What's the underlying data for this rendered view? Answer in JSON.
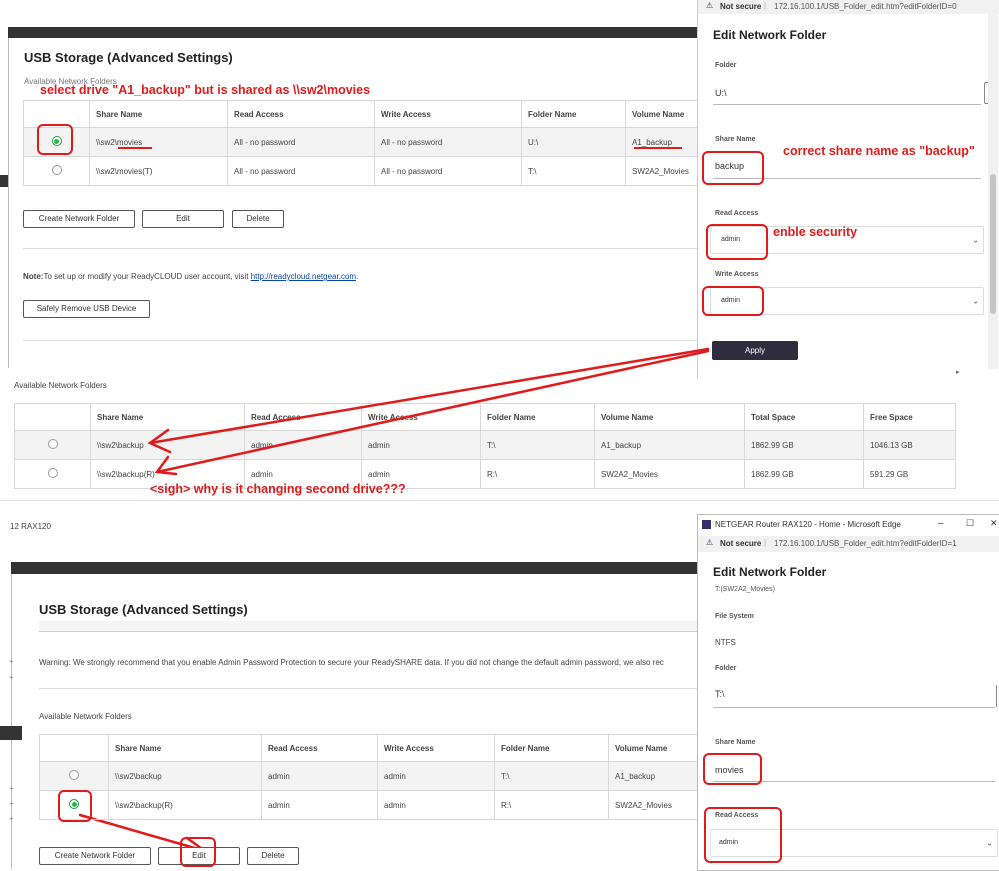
{
  "top": {
    "page_title": "USB Storage (Advanced Settings)",
    "available_label": "Available Network Folders",
    "columns": [
      "Share Name",
      "Read Access",
      "Write Access",
      "Folder Name",
      "Volume Name"
    ],
    "rows": [
      {
        "share_prefix": "\\\\sw2\\",
        "share_suffix": "movies",
        "read": "All - no password",
        "write": "All - no password",
        "folder": "U:\\",
        "volume": "A1_backup",
        "selected": true
      },
      {
        "share_prefix": "\\\\sw2\\",
        "share_suffix": "movies(T)",
        "read": "All - no password",
        "write": "All - no password",
        "folder": "T:\\",
        "volume": "SW2A2_Movies",
        "selected": false
      }
    ],
    "create_button": "Create Network Folder",
    "edit_button": "Edit",
    "delete_button": "Delete",
    "note_label": "Note:",
    "note_text": "To set up or modify your ReadyCLOUD user account, visit ",
    "note_link": "http://readycloud.netgear.com",
    "note_end": ".",
    "safely_remove_button": "Safely Remove USB Device"
  },
  "top_panel": {
    "not_secure": "Not secure",
    "url": "172.16.100.1/USB_Folder_edit.htm?editFolderID=0",
    "title": "Edit Network Folder",
    "folder_label": "Folder",
    "folder_value": "U:\\",
    "share_label": "Share Name",
    "share_value": "backup",
    "read_label": "Read Access",
    "read_value": "admin",
    "write_label": "Write Access",
    "write_value": "admin",
    "apply_button": "Apply"
  },
  "middle": {
    "available_label": "Available Network Folders",
    "columns": [
      "Share Name",
      "Read Access",
      "Write Access",
      "Folder Name",
      "Volume Name",
      "Total Space",
      "Free Space"
    ],
    "rows": [
      {
        "share": "\\\\sw2\\backup",
        "read": "admin",
        "write": "admin",
        "folder": "T:\\",
        "volume": "A1_backup",
        "total": "1862.99 GB",
        "free": "1046.13 GB"
      },
      {
        "share": "\\\\sw2\\backup(R)",
        "read": "admin",
        "write": "admin",
        "folder": "R:\\",
        "volume": "SW2A2_Movies",
        "total": "1862.99 GB",
        "free": "591.29 GB"
      }
    ]
  },
  "bottom": {
    "router_label": "12 RAX120",
    "page_title": "USB Storage (Advanced Settings)",
    "warning": "Warning: We strongly recommend that you enable Admin Password Protection to secure your ReadySHARE data. If you did not change the default admin password, we also rec",
    "available_label": "Available Network Folders",
    "columns": [
      "Share Name",
      "Read Access",
      "Write Access",
      "Folder Name",
      "Volume Name"
    ],
    "rows": [
      {
        "share": "\\\\sw2\\backup",
        "read": "admin",
        "write": "admin",
        "folder": "T:\\",
        "volume": "A1_backup",
        "selected": false
      },
      {
        "share": "\\\\sw2\\backup(R)",
        "read": "admin",
        "write": "admin",
        "folder": "R:\\",
        "volume": "SW2A2_Movies",
        "selected": true
      }
    ],
    "create_button": "Create Network Folder",
    "edit_button": "Edit",
    "delete_button": "Delete"
  },
  "bottom_panel": {
    "window_title": "NETGEAR Router RAX120 - Home - Microsoft Edge",
    "minimize": "–",
    "maximize": "☐",
    "close": "✕",
    "not_secure": "Not secure",
    "url": "172.16.100.1/USB_Folder_edit.htm?editFolderID=1",
    "title": "Edit Network Folder",
    "subtitle": "T:(SW2A2_Movies)",
    "fs_label": "File System",
    "fs_value": "NTFS",
    "folder_label": "Folder",
    "folder_value": "T:\\",
    "share_label": "Share Name",
    "share_value": "movies",
    "read_label": "Read Access",
    "read_value": "admin"
  },
  "annotations": {
    "select_drive": "select drive \"A1_backup\" but is shared as \\\\sw2\\movies",
    "correct_share": "correct share name as \"backup\"",
    "enable_security": "enble security",
    "sigh": "<sigh> why is it changing second drive???"
  },
  "colors": {
    "annotation_red": "#e01b1b",
    "radio_green": "#2db34a",
    "apply_dark": "#2f2c3d",
    "top_bar": "#333333"
  }
}
